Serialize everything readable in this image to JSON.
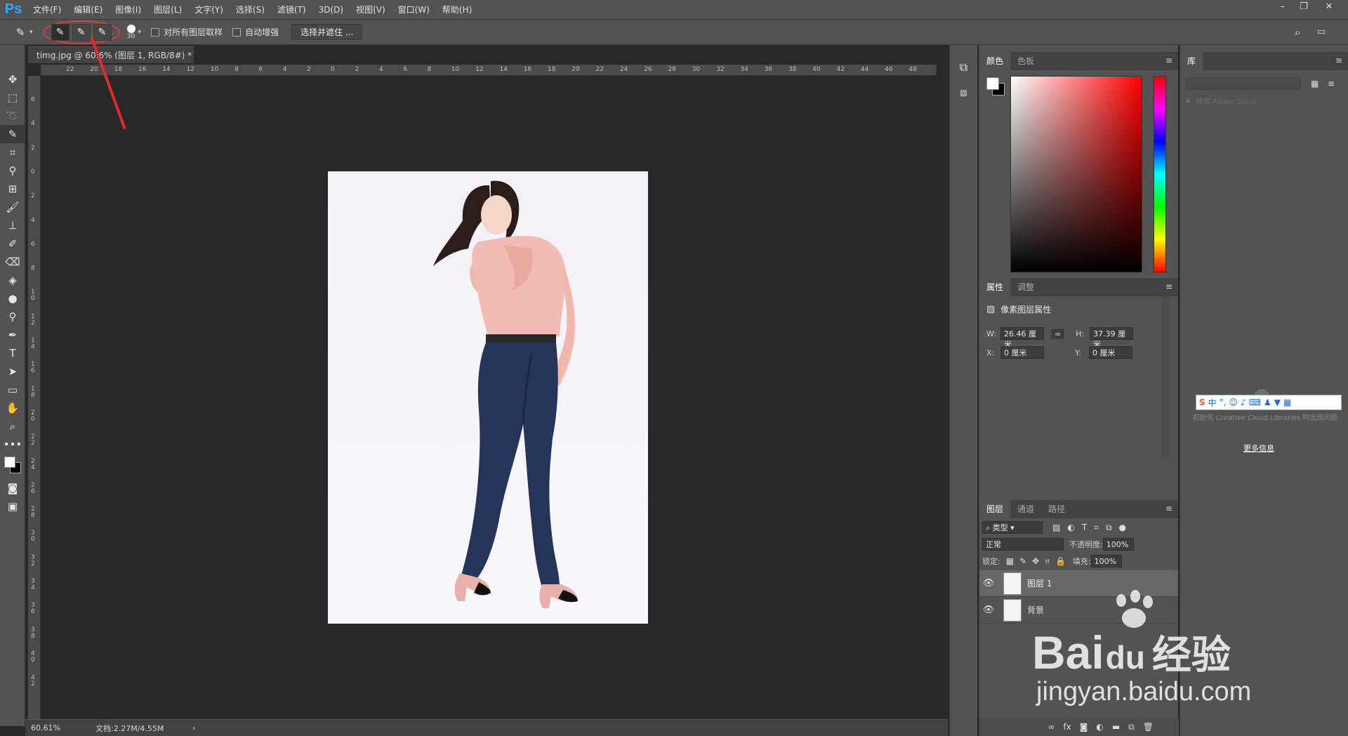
{
  "app": {
    "logo": "Ps"
  },
  "menu": [
    "文件(F)",
    "编辑(E)",
    "图像(I)",
    "图层(L)",
    "文字(Y)",
    "选择(S)",
    "滤镜(T)",
    "3D(D)",
    "视图(V)",
    "窗口(W)",
    "帮助(H)"
  ],
  "window_controls": [
    "–",
    "❐",
    "✕"
  ],
  "options": {
    "brush_size": "30",
    "sample_all_layers": "对所有图层取样",
    "auto_enhance": "自动增强",
    "select_mask_button": "选择并遮住 ..."
  },
  "document": {
    "tab_title": "timg.jpg @ 60.6% (图层 1, RGB/8#) *",
    "tab_close": "×"
  },
  "ruler": {
    "h_ticks": [
      "22",
      "20",
      "18",
      "16",
      "14",
      "12",
      "10",
      "8",
      "6",
      "4",
      "2",
      "0",
      "2",
      "4",
      "6",
      "8",
      "10",
      "12",
      "14",
      "16",
      "18",
      "20",
      "22",
      "24",
      "26",
      "28",
      "30",
      "32",
      "34",
      "36",
      "38",
      "40",
      "42",
      "44",
      "46",
      "48"
    ],
    "v_ticks": [
      "6",
      "4",
      "2",
      "0",
      "2",
      "4",
      "6",
      "8",
      "1 0",
      "1 2",
      "1 4",
      "1 6",
      "1 8",
      "2 0",
      "2 2",
      "2 4",
      "2 6",
      "2 8",
      "3 0",
      "3 2",
      "3 4",
      "3 6",
      "3 8",
      "4 0",
      "4 2"
    ]
  },
  "status": {
    "zoom": "60.61%",
    "doc_info": "文档:2.27M/4.55M",
    "arrow": "›"
  },
  "color_panel": {
    "tabs": [
      "颜色",
      "色板"
    ],
    "fg_color": "#ffffff",
    "bg_color": "#000000"
  },
  "properties_panel": {
    "tabs": [
      "属性",
      "调整"
    ],
    "title": "像素图层属性",
    "w_label": "W:",
    "w_value": "26.46 厘米",
    "h_label": "H:",
    "h_value": "37.39 厘米",
    "x_label": "X:",
    "x_value": "0 厘米",
    "y_label": "Y:",
    "y_value": "0 厘米"
  },
  "layers_panel": {
    "tabs": [
      "图层",
      "通道",
      "路径"
    ],
    "filter_label": "类型",
    "blend_mode": "正常",
    "opacity_label": "不透明度:",
    "opacity_value": "100%",
    "lock_label": "锁定:",
    "fill_label": "填充:",
    "fill_value": "100%",
    "layers": [
      {
        "name": "图层 1",
        "active": true
      },
      {
        "name": "背景",
        "active": false
      }
    ]
  },
  "library_panel": {
    "tab": "库",
    "search_placeholder": "搜索 Adobe Stock",
    "init_msg": "初始化 Creative Cloud Libraries 时出现问题",
    "more_info": "更多信息"
  },
  "ime_bar": {
    "label": "中",
    "extra": "°,"
  },
  "watermark": {
    "brand": "Bai",
    "brand_du": "du",
    "cn": "经验",
    "url": "jingyan.baidu.com"
  }
}
